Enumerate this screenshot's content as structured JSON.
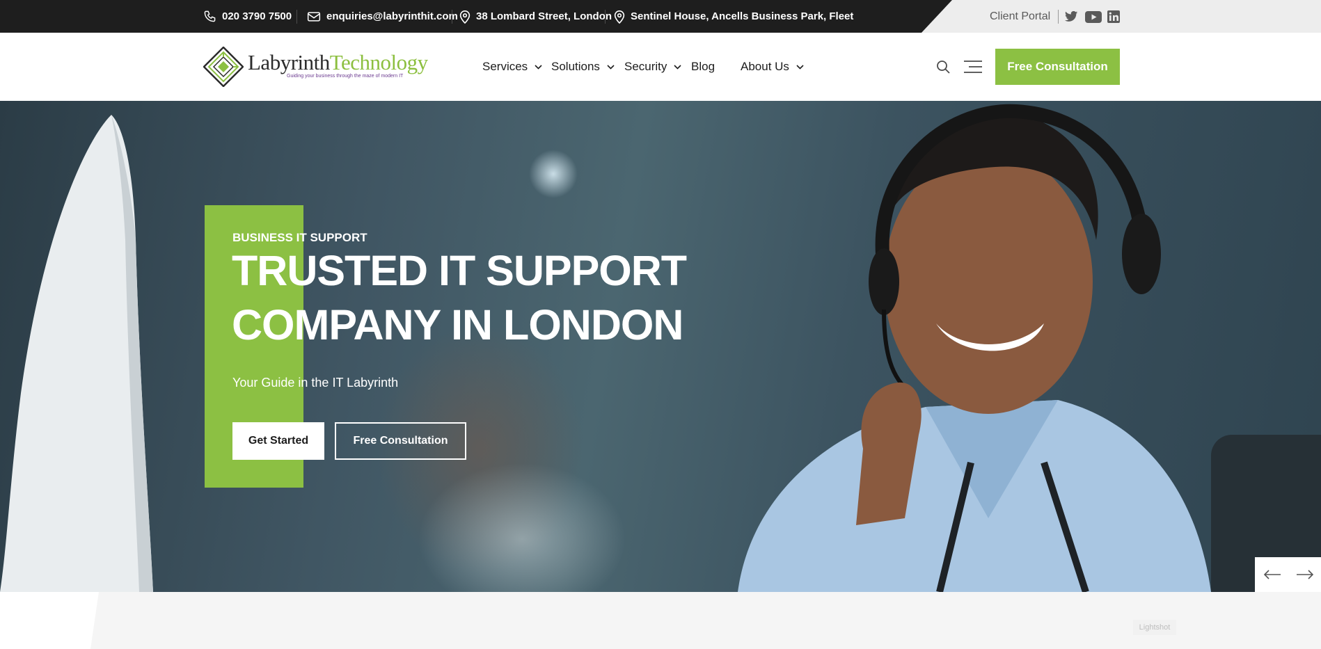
{
  "topbar": {
    "phone": "020 3790 7500",
    "email": "enquiries@labyrinthit.com",
    "address_1": "38 Lombard Street, London",
    "address_2": "Sentinel House, Ancells Business Park, Fleet",
    "client_portal": "Client Portal",
    "icons": [
      "phone-icon",
      "email-icon",
      "location-pin-icon",
      "location-pin-icon",
      "twitter-icon",
      "youtube-icon",
      "linkedin-icon"
    ]
  },
  "header": {
    "logo": {
      "name_part_1": "Labyrinth",
      "name_part_2": "Technology",
      "tagline": "Guiding your business through the maze of modern IT"
    },
    "nav": [
      {
        "label": "Services",
        "has_dropdown": true
      },
      {
        "label": "Solutions",
        "has_dropdown": true
      },
      {
        "label": "Security",
        "has_dropdown": true
      },
      {
        "label": "Blog",
        "has_dropdown": false
      },
      {
        "label": "About Us",
        "has_dropdown": true
      }
    ],
    "icons": [
      "search-icon",
      "menu-icon"
    ],
    "cta_label": "Free Consultation"
  },
  "hero": {
    "eyebrow": "BUSINESS IT SUPPORT",
    "title_line_1": "TRUSTED IT SUPPORT",
    "title_line_2": "COMPANY IN LONDON",
    "subtitle": "Your Guide in the IT Labyrinth",
    "primary_button": "Get Started",
    "secondary_button": "Free Consultation",
    "slider_icons": [
      "arrow-left-icon",
      "arrow-right-icon"
    ]
  },
  "overlay": {
    "lightshot": "Lightshot"
  },
  "colors": {
    "brand_green": "#8cc043",
    "topbar_dark": "#1e1e1e",
    "topbar_light": "#ededed",
    "text_dark": "#1c1c1c",
    "logo_purple": "#6b3a8f"
  }
}
